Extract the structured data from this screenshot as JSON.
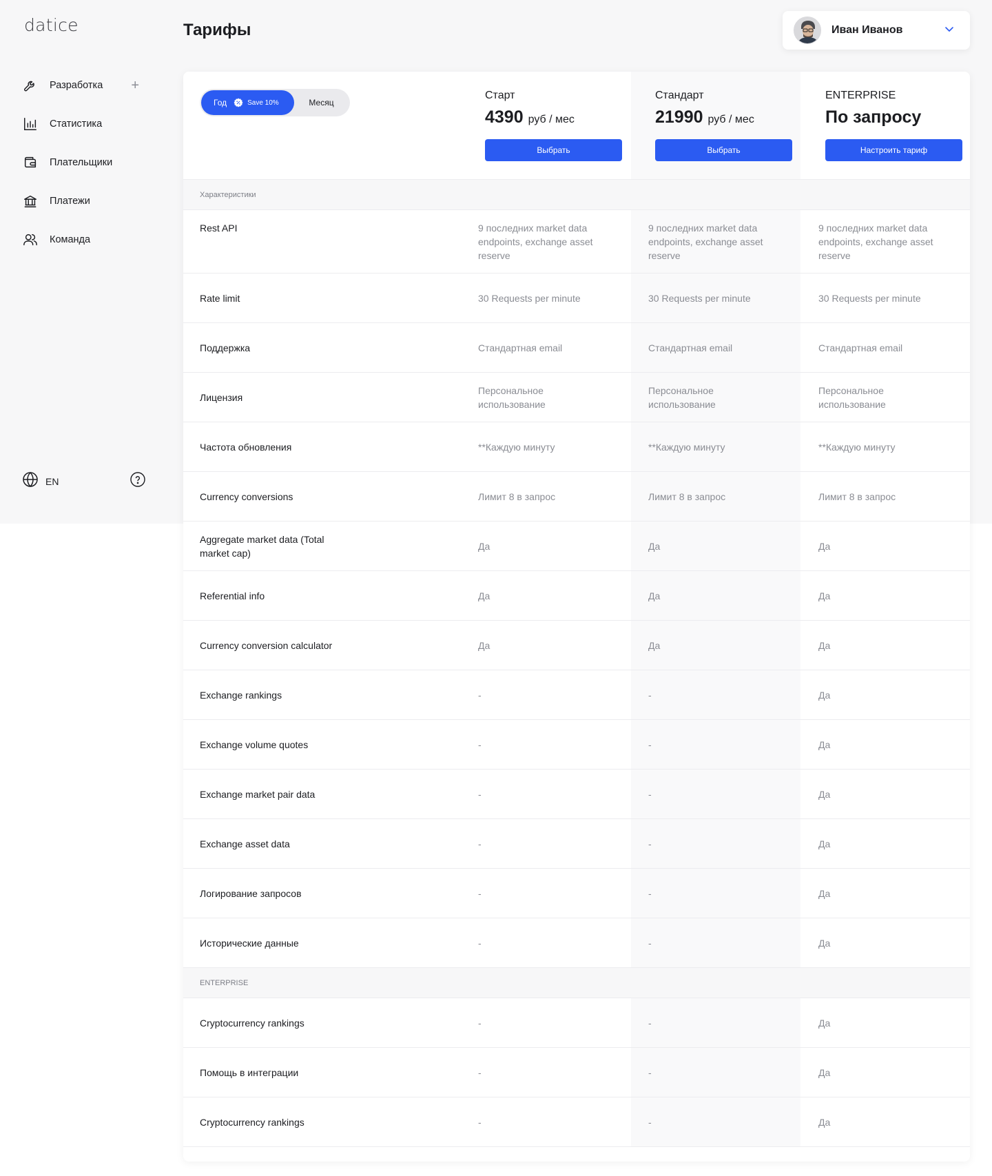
{
  "app": {
    "logo": "datice"
  },
  "sidebar": {
    "items": [
      {
        "label": "Разработка",
        "icon": "wrench-icon"
      },
      {
        "label": "Статистика",
        "icon": "bar-chart-icon"
      },
      {
        "label": "Плательщики",
        "icon": "wallet-icon"
      },
      {
        "label": "Платежи",
        "icon": "bank-icon"
      },
      {
        "label": "Команда",
        "icon": "users-icon"
      }
    ],
    "add_icon": "plus-icon",
    "language": "EN",
    "language_icon": "globe-icon",
    "help_icon": "question-circle-icon"
  },
  "header": {
    "title": "Тарифы",
    "user_name": "Иван Иванов"
  },
  "billing_toggle": {
    "year_label": "Год",
    "save_badge": "Save 10%",
    "month_label": "Месяц",
    "selected": "year"
  },
  "plans": [
    {
      "name": "Старт",
      "price": "4390",
      "unit": "руб / мес",
      "button": "Выбрать"
    },
    {
      "name": "Стандарт",
      "price": "21990",
      "unit": "руб / мес",
      "button": "Выбрать"
    },
    {
      "name": "ENTERPRISE",
      "price_text": "По запросу",
      "button": "Настроить тариф"
    }
  ],
  "sections": [
    {
      "title": "Характеристики",
      "rows": [
        {
          "feature": "Rest API",
          "values": [
            "9 последних market data endpoints, exchange asset reserve",
            "9 последних market data endpoints, exchange asset reserve",
            "9 последних market data endpoints, exchange asset reserve"
          ]
        },
        {
          "feature": "Rate limit",
          "values": [
            "30 Requests per minute",
            "30 Requests per minute",
            "30 Requests per minute"
          ]
        },
        {
          "feature": "Поддержка",
          "values": [
            "Стандартная email",
            "Стандартная email",
            "Стандартная email"
          ]
        },
        {
          "feature": "Лицензия",
          "values": [
            "Персональное использование",
            "Персональное использование",
            "Персональное использование"
          ]
        },
        {
          "feature": "Частота обновления",
          "values": [
            "**Каждую минуту",
            "**Каждую минуту",
            "**Каждую минуту"
          ]
        },
        {
          "feature": "Currency conversions",
          "values": [
            "Лимит 8 в запрос",
            "Лимит 8 в запрос",
            "Лимит 8 в запрос"
          ]
        },
        {
          "feature": "Aggregate market data (Total market cap)",
          "values": [
            "Да",
            "Да",
            "Да"
          ]
        },
        {
          "feature": "Referential info",
          "values": [
            "Да",
            "Да",
            "Да"
          ]
        },
        {
          "feature": "Currency conversion calculator",
          "values": [
            "Да",
            "Да",
            "Да"
          ]
        },
        {
          "feature": "Exchange rankings",
          "values": [
            "-",
            "-",
            "Да"
          ]
        },
        {
          "feature": "Exchange volume quotes",
          "values": [
            "-",
            "-",
            "Да"
          ]
        },
        {
          "feature": "Exchange market pair data",
          "values": [
            "-",
            "-",
            "Да"
          ]
        },
        {
          "feature": "Exchange asset data",
          "values": [
            "-",
            "-",
            "Да"
          ]
        },
        {
          "feature": "Логирование запросов",
          "values": [
            "-",
            "-",
            "Да"
          ]
        },
        {
          "feature": "Исторические данные",
          "values": [
            "-",
            "-",
            "Да"
          ]
        }
      ]
    },
    {
      "title": "ENTERPRISE",
      "rows": [
        {
          "feature": "Cryptocurrency rankings",
          "values": [
            "-",
            "-",
            "Да"
          ]
        },
        {
          "feature": "Помощь в интеграции",
          "values": [
            "-",
            "-",
            "Да"
          ]
        },
        {
          "feature": "Cryptocurrency rankings",
          "values": [
            "-",
            "-",
            "Да"
          ]
        }
      ]
    }
  ],
  "colors": {
    "accent": "#2b5bf2",
    "background": "#f7f7f8",
    "muted_text": "#8a8c93"
  }
}
